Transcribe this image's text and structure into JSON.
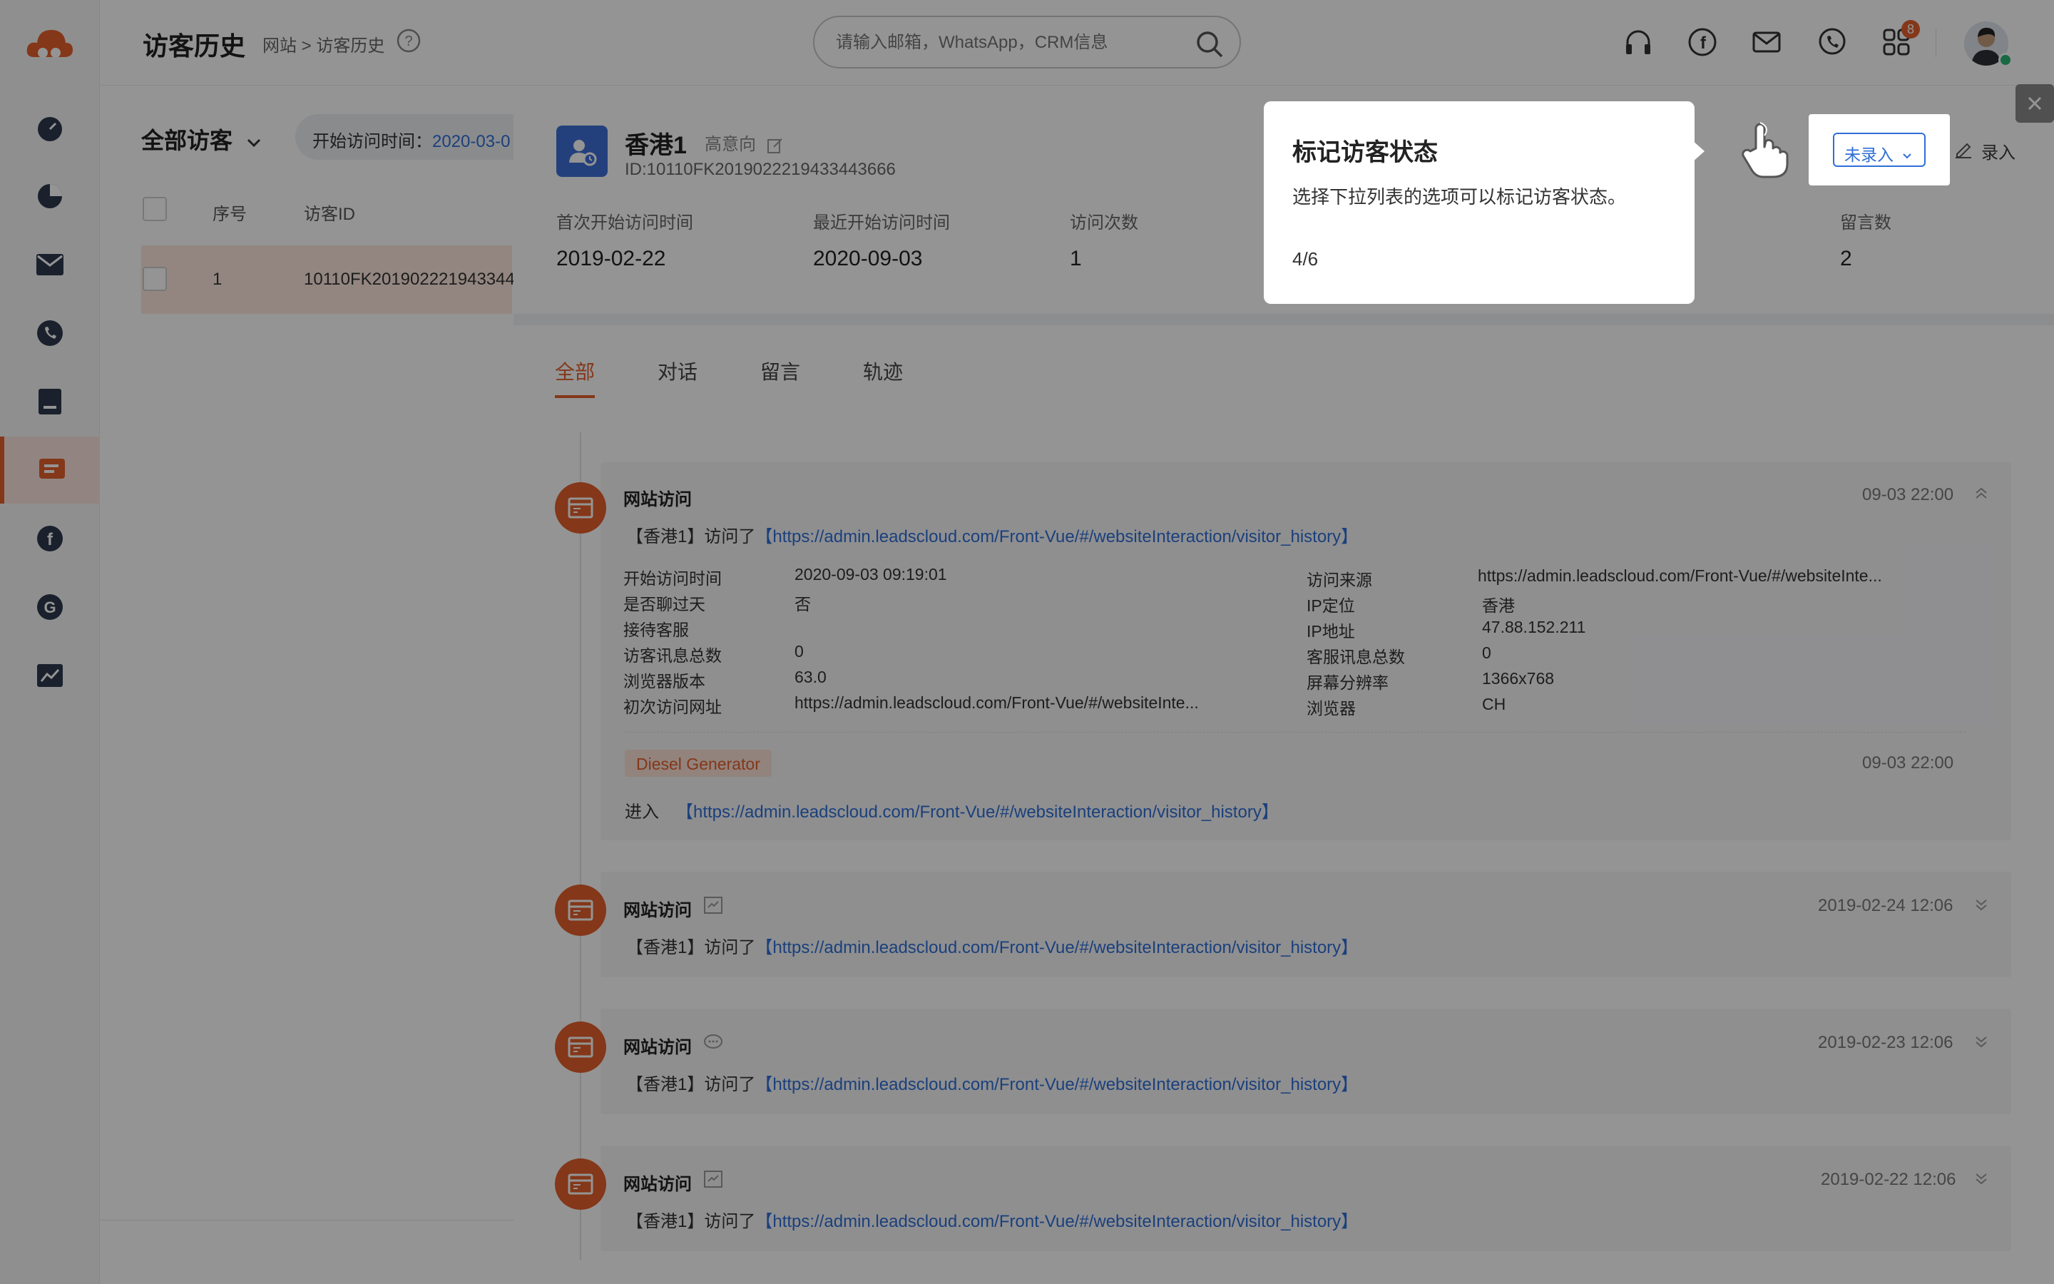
{
  "header": {
    "title": "访客历史",
    "breadcrumb": "网站 > 访客历史",
    "search_placeholder": "请输入邮箱，WhatsApp，CRM信息",
    "notification_count": "8"
  },
  "sidebar": {
    "items": [
      {
        "icon": "dashboard-icon"
      },
      {
        "icon": "pie-chart-icon"
      },
      {
        "icon": "mail-icon"
      },
      {
        "icon": "phone-icon"
      },
      {
        "icon": "folder-icon"
      },
      {
        "icon": "chat-icon",
        "active": true
      },
      {
        "icon": "facebook-icon"
      },
      {
        "icon": "google-icon"
      },
      {
        "icon": "analytics-icon"
      }
    ],
    "accent": "#e45f2b"
  },
  "list": {
    "filter_label": "全部访客",
    "chip_label": "开始访问时间：",
    "chip_value": "2020-03-0",
    "columns": [
      "序号",
      "访客ID"
    ],
    "rows": [
      {
        "index": "1",
        "visitor_id": "10110FK201902221943344"
      }
    ]
  },
  "visitor": {
    "name": "香港1",
    "intent": "高意向",
    "id": "ID:10110FK2019022219433443666",
    "stats": [
      {
        "label": "首次开始访问时间",
        "value": "2019-02-22"
      },
      {
        "label": "最近开始访问时间",
        "value": "2020-09-03"
      },
      {
        "label": "访问次数",
        "value": "1"
      },
      {
        "label": "留言数",
        "value": "2"
      }
    ],
    "status_select": "未录入",
    "record_label": "录入"
  },
  "tabs": [
    "全部",
    "对话",
    "留言",
    "轨迹"
  ],
  "events": [
    {
      "title": "网站访问",
      "time": "09-03 22:00",
      "prefix": "【香港1】访问了",
      "url": "【https://admin.leadscloud.com/Front-Vue/#/websiteInteraction/visitor_history】",
      "details_left": [
        {
          "k": "开始访问时间",
          "v": "2020-09-03 09:19:01"
        },
        {
          "k": "是否聊过天",
          "v": "否"
        },
        {
          "k": "接待客服",
          "v": ""
        },
        {
          "k": "访客讯息总数",
          "v": "0"
        },
        {
          "k": "浏览器版本",
          "v": "63.0"
        },
        {
          "k": "初次访问网址",
          "v": "https://admin.leadscloud.com/Front-Vue/#/websiteInte..."
        }
      ],
      "details_right": [
        {
          "k": "访问来源",
          "v": "https://admin.leadscloud.com/Front-Vue/#/websiteInte..."
        },
        {
          "k": "IP定位",
          "v": "香港"
        },
        {
          "k": "IP地址",
          "v": "47.88.152.211"
        },
        {
          "k": "客服讯息总数",
          "v": "0"
        },
        {
          "k": "屏幕分辨率",
          "v": "1366x768"
        },
        {
          "k": "浏览器",
          "v": "CH"
        }
      ],
      "tag": "Diesel Generator",
      "tag_time": "09-03 22:00",
      "enter_label": "进入",
      "enter_url": "【https://admin.leadscloud.com/Front-Vue/#/websiteInteraction/visitor_history】"
    },
    {
      "title": "网站访问",
      "time": "2019-02-24 12:06",
      "prefix": "【香港1】访问了",
      "url": "【https://admin.leadscloud.com/Front-Vue/#/websiteInteraction/visitor_history】"
    },
    {
      "title": "网站访问",
      "time": "2019-02-23 12:06",
      "prefix": "【香港1】访问了",
      "url": "【https://admin.leadscloud.com/Front-Vue/#/websiteInteraction/visitor_history】"
    },
    {
      "title": "网站访问",
      "time": "2019-02-22 12:06",
      "prefix": "【香港1】访问了",
      "url": "【https://admin.leadscloud.com/Front-Vue/#/websiteInteraction/visitor_history】"
    }
  ],
  "guide": {
    "title": "标记访客状态",
    "description": "选择下拉列表的选项可以标记访客状态。",
    "step": "4/6"
  }
}
